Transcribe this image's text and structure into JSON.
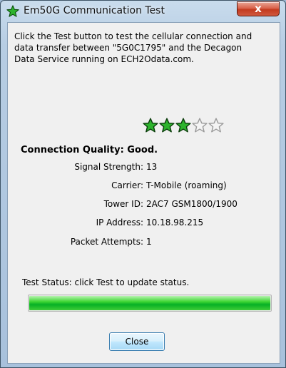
{
  "window": {
    "title": "Em50G Communication Test",
    "close_glyph": "x",
    "app_icon": "green-star-icon"
  },
  "description": "Click the Test button to test the cellular connection and data transfer between \"5G0C1795\" and the Decagon Data Service running on ECH2Odata.com.",
  "quality": {
    "stars_filled": 3,
    "stars_total": 5,
    "label": "Connection Quality: Good."
  },
  "details": [
    {
      "label": "Signal Strength:",
      "value": "13"
    },
    {
      "label": "Carrier:",
      "value": "T-Mobile (roaming)"
    },
    {
      "label": "Tower ID:",
      "value": "2AC7 GSM1800/1900"
    },
    {
      "label": "IP Address:",
      "value": "10.18.98.215"
    },
    {
      "label": "Packet Attempts:",
      "value": "1"
    }
  ],
  "status": "Test Status: click Test to update status.",
  "progress_fraction": 1.0,
  "buttons": {
    "close": "Close"
  },
  "colors": {
    "star_fill": "#2db32d",
    "progress": "#06b025",
    "close_red": "#c23a1f"
  }
}
